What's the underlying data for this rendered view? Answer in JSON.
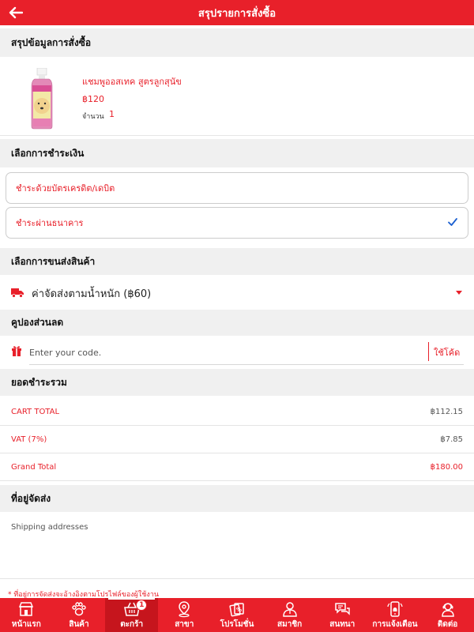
{
  "header": {
    "title": "สรุปรายการสั่งซื้อ",
    "back_icon": "arrow-left-icon"
  },
  "order_summary": {
    "heading": "สรุปข้อมูลการสั่งซื้อ",
    "product": {
      "name": "แชมพูออสเทค สูตรลูกสุนัข",
      "price": "฿120",
      "quantity_label": "จำนวน",
      "quantity": "1"
    }
  },
  "payment": {
    "heading": "เลือกการชำระเงิน",
    "options": [
      {
        "label": "ชำระด้วยบัตรเครดิต/เดบิต",
        "selected": false
      },
      {
        "label": "ชำระผ่านธนาคาร",
        "selected": true
      }
    ]
  },
  "shipping": {
    "heading": "เลือกการขนส่งสินค้า",
    "selected": "ค่าจัดส่งตามน้ำหนัก (฿60)"
  },
  "coupon": {
    "heading": "คูปองส่วนลด",
    "placeholder": "Enter your code.",
    "value": "",
    "use_label": "ใช้โค้ด"
  },
  "totals": {
    "heading": "ยอดชำระรวม",
    "rows": [
      {
        "label": "CART TOTAL",
        "value": "฿112.15"
      },
      {
        "label": "VAT (7%)",
        "value": "฿7.85"
      },
      {
        "label": "Grand Total",
        "value": "฿180.00"
      }
    ]
  },
  "address": {
    "heading": "ที่อยู่จัดส่ง",
    "text": "Shipping addresses",
    "note": "* ที่อยู่การจัดส่งจะอ้างอิงตามโปรไฟล์ของผู้ใช้งาน"
  },
  "bottom_nav": {
    "items": [
      {
        "label": "หน้าแรก",
        "icon": "store-icon"
      },
      {
        "label": "สินค้า",
        "icon": "paw-icon"
      },
      {
        "label": "ตะกร้า",
        "icon": "basket-icon",
        "badge": "1",
        "active": true
      },
      {
        "label": "สาขา",
        "icon": "location-pin-icon"
      },
      {
        "label": "โปรโมชั่น",
        "icon": "coupon-icon"
      },
      {
        "label": "สมาชิก",
        "icon": "member-icon"
      },
      {
        "label": "สนทนา",
        "icon": "chat-icon"
      },
      {
        "label": "การแจ้งเตือน",
        "icon": "bell-phone-icon"
      },
      {
        "label": "ติดต่อ",
        "icon": "contact-icon"
      }
    ]
  },
  "colors": {
    "primary": "#e8202a",
    "section_bg": "#f0f0f0"
  }
}
